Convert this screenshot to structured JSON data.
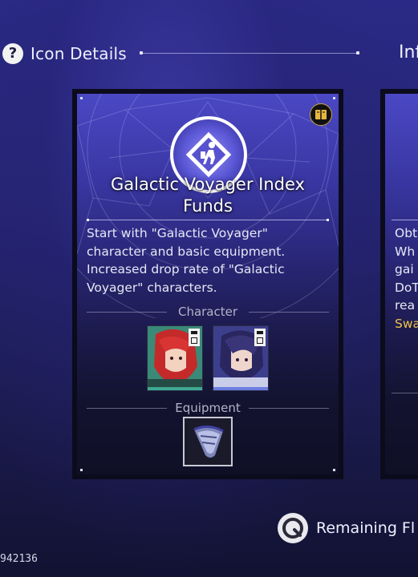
{
  "header": {
    "help_icon_glyph": "?",
    "title": "Icon Details",
    "right_title_partial": "Inf"
  },
  "card": {
    "title_line1": "Galactic Voyager Index",
    "title_line2": "Funds",
    "description_lines": [
      "Start with \"Galactic Voyager\"",
      "character and basic equipment.",
      "Increased drop rate of \"Galactic",
      "Voyager\" characters."
    ],
    "character_section_label": "Character",
    "equipment_section_label": "Equipment",
    "characters": [
      {
        "name": "red-haired-character",
        "accent": "#3fa890"
      },
      {
        "name": "dark-haired-character",
        "accent": "#6c7ee0"
      }
    ],
    "equipment": [
      {
        "name": "light-cone-equipment"
      }
    ],
    "top_right_icon": "book-icon"
  },
  "card2": {
    "lines": [
      "Obt",
      "Wh",
      "gai",
      "DoT",
      "rea",
      "Swa"
    ]
  },
  "remaining": {
    "label": "Remaining Fl"
  },
  "uid": "942136",
  "colors": {
    "gold": "#f0c247",
    "card_top": "#4b48c4",
    "background": "#24236f"
  }
}
